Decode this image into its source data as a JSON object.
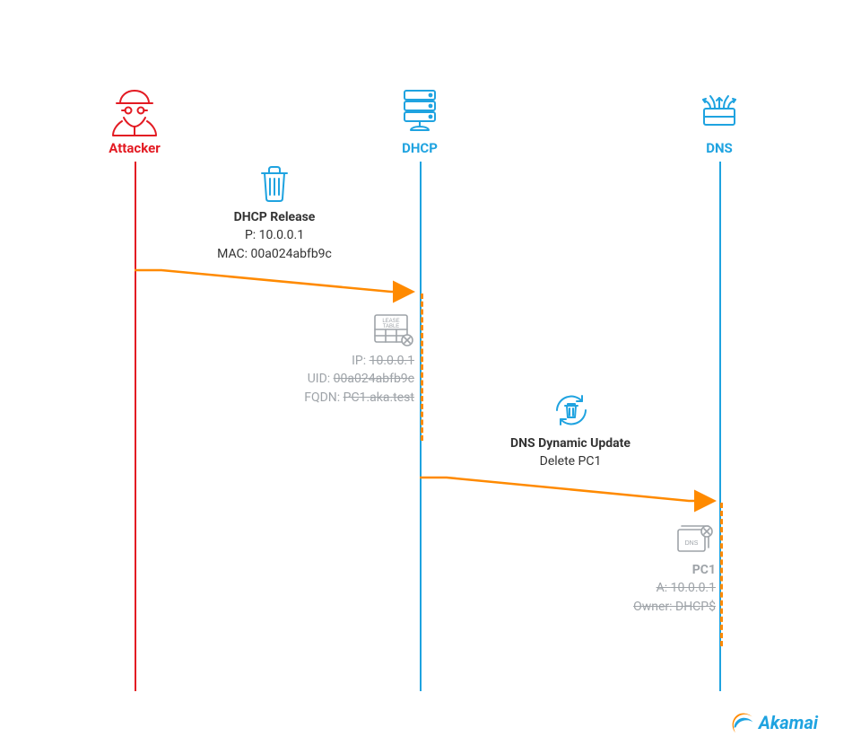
{
  "actors": {
    "attacker": {
      "label": "Attacker",
      "color": "#e31b23"
    },
    "dhcp": {
      "label": "DHCP",
      "color": "#1fa3e0"
    },
    "dns": {
      "label": "DNS",
      "color": "#1fa3e0"
    }
  },
  "messages": {
    "release": {
      "title": "DHCP Release",
      "line1_label": "P: ",
      "line1_value": "10.0.0.1",
      "line2_label": "MAC: ",
      "line2_value": "00a024abfb9c"
    },
    "leaseTable": {
      "iconLabel1": "LEASE",
      "iconLabel2": "TABLE",
      "ip_label": "IP: ",
      "ip_value": "10.0.0.1",
      "uid_label": "UID: ",
      "uid_value": "00a024abfb9c",
      "fqdn_label": "FQDN: ",
      "fqdn_value": "PC1.aka.test"
    },
    "dnsUpdate": {
      "title": "DNS Dynamic Update",
      "line1": "Delete PC1"
    },
    "dnsRecord": {
      "iconLabel": "DNS",
      "host": "PC1",
      "a_label": "A: ",
      "a_value": "10.0.0.1",
      "owner_label": "Owner: ",
      "owner_value": "DHCP$"
    }
  },
  "brand": {
    "name": "Akamai"
  }
}
